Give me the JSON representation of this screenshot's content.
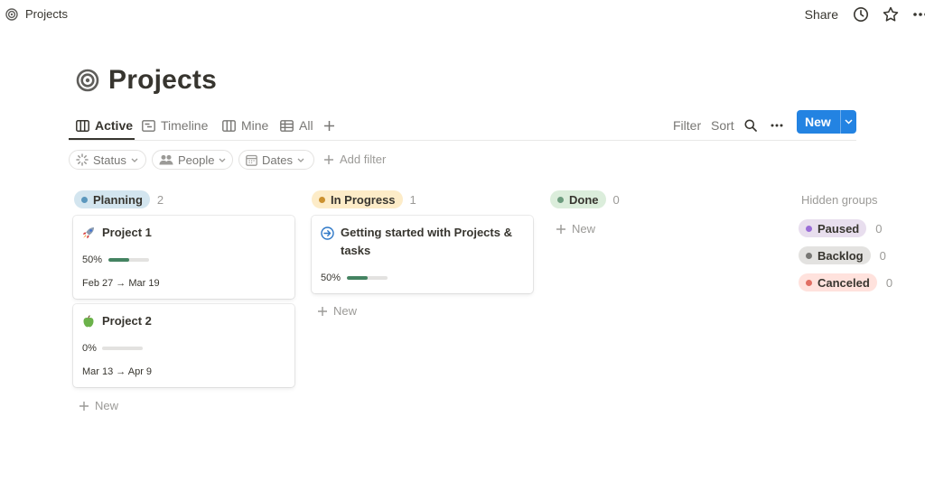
{
  "topbar": {
    "breadcrumb": "Projects",
    "share_label": "Share"
  },
  "page": {
    "title": "Projects"
  },
  "views": {
    "tabs": [
      {
        "label": "Active",
        "icon": "board-icon",
        "active": true
      },
      {
        "label": "Timeline",
        "icon": "timeline-icon",
        "active": false
      },
      {
        "label": "Mine",
        "icon": "board-icon",
        "active": false
      },
      {
        "label": "All",
        "icon": "table-icon",
        "active": false
      }
    ],
    "filter_label": "Filter",
    "sort_label": "Sort",
    "new_label": "New"
  },
  "filters": {
    "status": "Status",
    "people": "People",
    "dates": "Dates",
    "add_filter": "Add filter"
  },
  "columns": [
    {
      "name": "Planning",
      "count": "2",
      "color": "#d3e5ef",
      "dot": "#5b97bd",
      "cards": [
        {
          "title": "Project 1",
          "icon": "rocket-icon",
          "progress_label": "50%",
          "progress": 0.5,
          "dates": "Feb 27 → Mar 19"
        },
        {
          "title": "Project 2",
          "icon": "apple-icon",
          "progress_label": "0%",
          "progress": 0,
          "dates": "Mar 13 → Apr 9"
        }
      ],
      "new_label": "New"
    },
    {
      "name": "In Progress",
      "count": "1",
      "color": "#fdecc8",
      "dot": "#cb912f",
      "cards": [
        {
          "title_line1": "Getting started with Projects &",
          "title_line2": "tasks",
          "icon": "arrow-circle-icon",
          "progress_label": "50%",
          "progress": 0.5
        }
      ],
      "new_label": "New"
    },
    {
      "name": "Done",
      "count": "0",
      "color": "#dbeddb",
      "dot": "#6c9b7d",
      "cards": [],
      "new_label": "New"
    }
  ],
  "hidden_groups": {
    "title": "Hidden groups",
    "groups": [
      {
        "name": "Paused",
        "count": "0",
        "color": "#e8deee",
        "dot": "#9a6dd7"
      },
      {
        "name": "Backlog",
        "count": "0",
        "color": "#e3e2e0",
        "dot": "#787774"
      },
      {
        "name": "Canceled",
        "count": "0",
        "color": "#ffe2dd",
        "dot": "#e16f64"
      }
    ]
  }
}
